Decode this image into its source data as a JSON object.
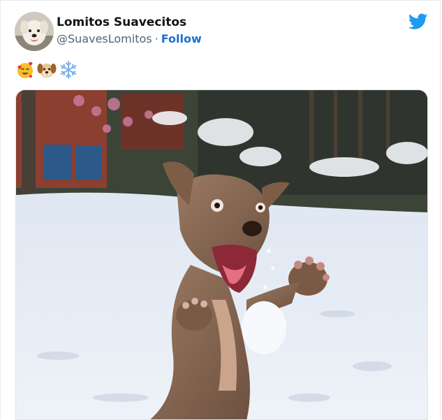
{
  "tweet": {
    "author_name": "Lomitos Suavecitos",
    "author_handle": "@SuavesLomitos",
    "separator": "·",
    "follow_label": "Follow",
    "emojis": [
      "smiling-face-with-hearts",
      "dog-face",
      "snowflake"
    ]
  },
  "icons": {
    "platform": "twitter-bird-icon"
  },
  "colors": {
    "brand_blue": "#1d9bf0",
    "follow_blue": "#1d6fd1",
    "name_text": "#0f1419",
    "handle_text": "#536471"
  }
}
